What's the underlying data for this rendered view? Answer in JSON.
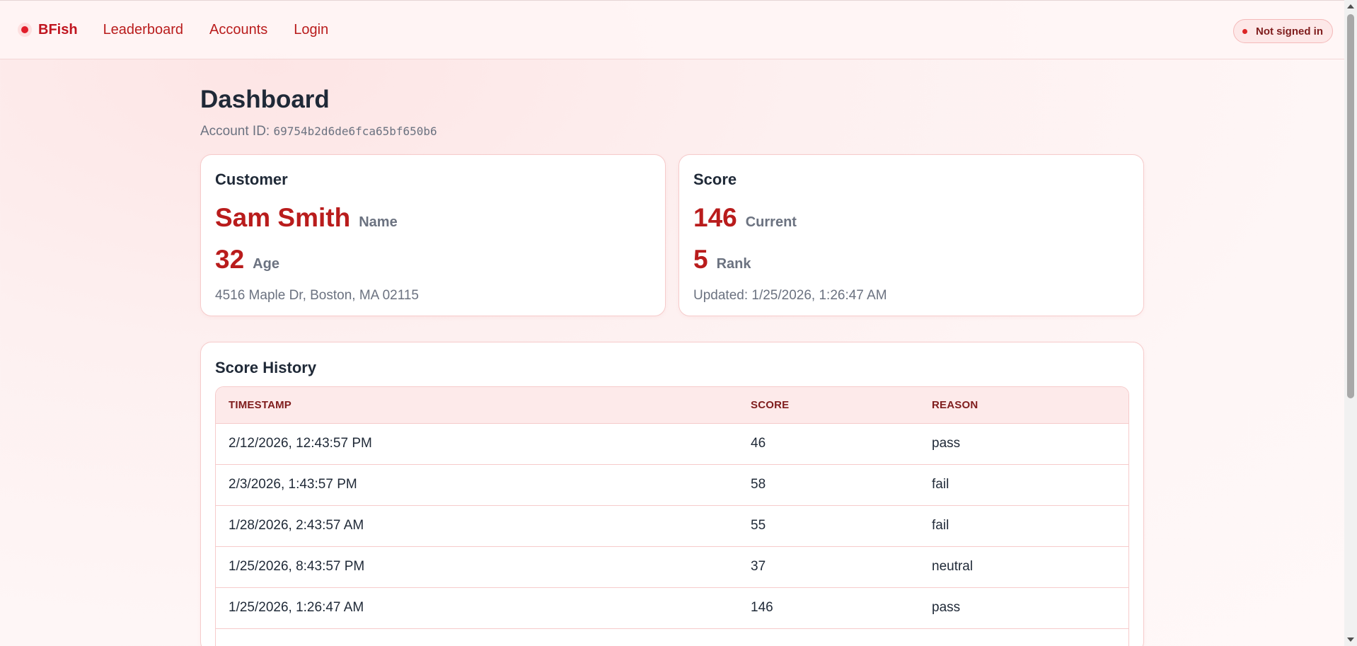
{
  "nav": {
    "brand": "BFish",
    "links": [
      "Leaderboard",
      "Accounts",
      "Login"
    ],
    "status": "Not signed in"
  },
  "page": {
    "title": "Dashboard",
    "account_label": "Account ID:",
    "account_id": "69754b2d6de6fca65bf650b6"
  },
  "customer": {
    "title": "Customer",
    "name": "Sam Smith",
    "name_label": "Name",
    "age": "32",
    "age_label": "Age",
    "address": "4516 Maple Dr, Boston, MA 02115"
  },
  "score": {
    "title": "Score",
    "current": "146",
    "current_label": "Current",
    "rank": "5",
    "rank_label": "Rank",
    "updated": "Updated: 1/25/2026, 1:26:47 AM"
  },
  "history": {
    "title": "Score History",
    "columns": [
      "TIMESTAMP",
      "SCORE",
      "REASON"
    ],
    "rows": [
      {
        "timestamp": "2/12/2026, 12:43:57 PM",
        "score": "46",
        "reason": "pass"
      },
      {
        "timestamp": "2/3/2026, 1:43:57 PM",
        "score": "58",
        "reason": "fail"
      },
      {
        "timestamp": "1/28/2026, 2:43:57 AM",
        "score": "55",
        "reason": "fail"
      },
      {
        "timestamp": "1/25/2026, 8:43:57 PM",
        "score": "37",
        "reason": "neutral"
      },
      {
        "timestamp": "1/25/2026, 1:26:47 AM",
        "score": "146",
        "reason": "pass"
      }
    ]
  },
  "colors": {
    "accent": "#b91c1c",
    "brand_dot": "#e11d2a",
    "muted_text": "#6b7280",
    "card_border": "#f6cbcb",
    "table_header_bg": "#fdeaea"
  }
}
